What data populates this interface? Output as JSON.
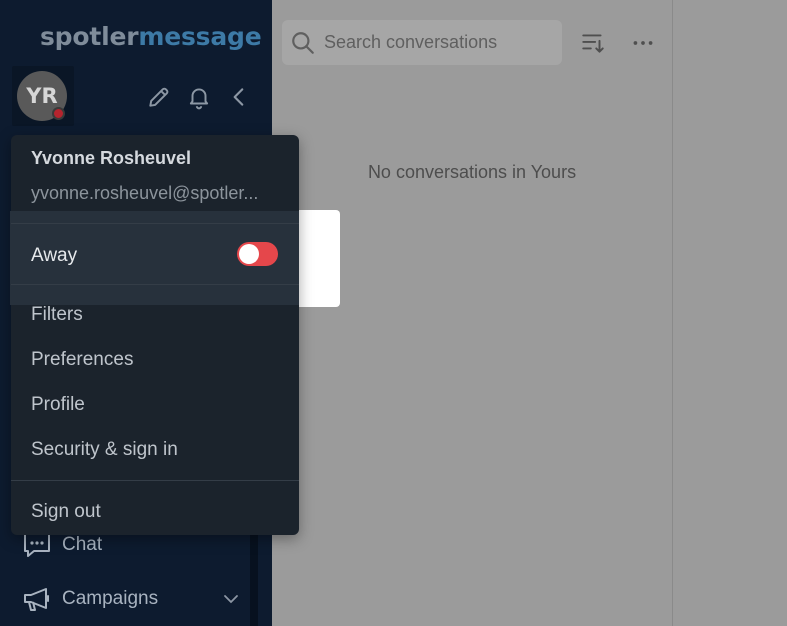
{
  "app": {
    "logo_part1": "spotler",
    "logo_part2": "message"
  },
  "user": {
    "initials": "YR",
    "name": "Yvonne Rosheuvel",
    "email": "yvonne.rosheuvel@spotler..."
  },
  "status_menu": {
    "away_label": "Away",
    "away_enabled": true,
    "items": [
      "Filters",
      "Preferences",
      "Profile",
      "Security & sign in"
    ],
    "sign_out": "Sign out"
  },
  "sidebar": {
    "nav": [
      {
        "label": "Chat",
        "icon": "chat-icon"
      },
      {
        "label": "Campaigns",
        "icon": "megaphone-icon"
      }
    ]
  },
  "conversations": {
    "search_placeholder": "Search conversations",
    "empty_text": "No conversations in Yours"
  },
  "colors": {
    "sidebar_bg": "#0d1b2f",
    "menu_bg": "#1b232c",
    "toggle_on": "#e5474b",
    "status_away": "#b5242e"
  }
}
